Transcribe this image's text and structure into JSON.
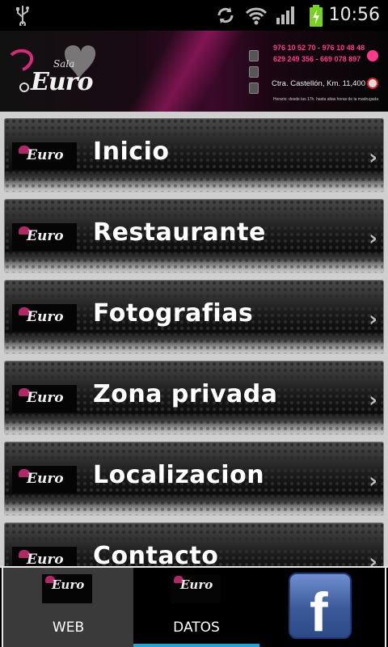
{
  "status_bar": {
    "time": "10:56",
    "icons": [
      "usb-icon",
      "sync-icon",
      "wifi-icon",
      "signal-icon",
      "battery-charging-icon"
    ]
  },
  "header": {
    "logo_text": "Euro",
    "logo_small": "Sala",
    "phones": [
      "976 10 52 70  -  976 10 48 48",
      "629 249 356  -  669 078 897"
    ],
    "address": "Ctra. Castellón, Km. 11,400",
    "hours": "Horario: desde las 17h. hasta altas horas de la madrugada"
  },
  "menu": {
    "items": [
      {
        "label": "Inicio",
        "icon": "euro-logo-icon"
      },
      {
        "label": "Restaurante",
        "icon": "euro-logo-icon"
      },
      {
        "label": "Fotografias",
        "icon": "euro-logo-icon"
      },
      {
        "label": "Zona privada",
        "icon": "euro-logo-icon"
      },
      {
        "label": "Localizacion",
        "icon": "euro-logo-icon"
      },
      {
        "label": "Contacto",
        "icon": "euro-logo-icon"
      }
    ],
    "chevron": "›",
    "mini_logo_text": "Euro"
  },
  "tabs": {
    "items": [
      {
        "label": "WEB",
        "icon": "euro-logo-icon",
        "selected": true
      },
      {
        "label": "DATOS",
        "icon": "euro-logo-icon",
        "selected": false
      },
      {
        "label": "",
        "icon": "facebook-icon",
        "selected": false
      }
    ],
    "fb_letter": "f"
  },
  "colors": {
    "accent_pink": "#ff3a8a",
    "tab_selected": "#3a3a3a",
    "tab_underline": "#1fa3d8",
    "facebook_blue": "#3b5998"
  }
}
